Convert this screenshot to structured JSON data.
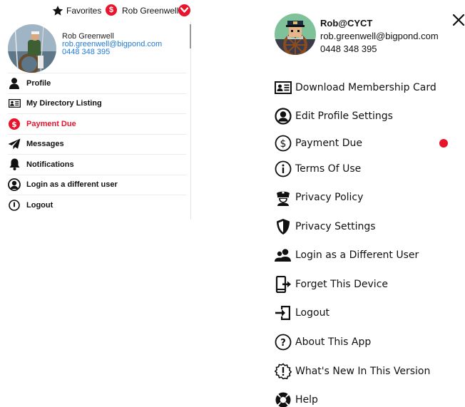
{
  "topbar": {
    "favorites_label": "Favorites",
    "money_symbol": "$",
    "user_name": "Rob Greenwell"
  },
  "dropdown": {
    "profile": {
      "name": "Rob Greenwell",
      "email": "rob.greenwell@bigpond.com",
      "phone": "0448 348 395"
    },
    "items": [
      {
        "label": "Profile",
        "icon": "person-icon"
      },
      {
        "label": "My Directory Listing",
        "icon": "id-card-icon"
      },
      {
        "label": "Payment Due",
        "icon": "dollar-badge-icon",
        "alert": true
      },
      {
        "label": "Messages",
        "icon": "paper-plane-icon"
      },
      {
        "label": "Notifications",
        "icon": "bell-icon"
      },
      {
        "label": "Login as a different user",
        "icon": "user-circle-icon"
      },
      {
        "label": "Logout",
        "icon": "power-icon"
      }
    ]
  },
  "side_menu": {
    "header": {
      "name": "Rob@CYCT",
      "email": "rob.greenwell@bigpond.com",
      "phone": "0448 348 395"
    },
    "items": [
      {
        "label": "Download Membership Card",
        "icon": "id-card-icon"
      },
      {
        "label": "Edit Profile Settings",
        "icon": "user-circle-icon"
      },
      {
        "label": "Payment Due",
        "icon": "dollar-circle-icon",
        "alert": true
      },
      {
        "label": "Terms Of Use",
        "icon": "info-circle-icon"
      },
      {
        "label": "Privacy Policy",
        "icon": "police-officer-icon"
      },
      {
        "label": "Privacy Settings",
        "icon": "shield-icon"
      },
      {
        "label": "Login as a Different User",
        "icon": "users-icon"
      },
      {
        "label": "Forget This Device",
        "icon": "device-exit-icon"
      },
      {
        "label": "Logout",
        "icon": "sign-out-icon"
      },
      {
        "label": "About This App",
        "icon": "question-circle-icon"
      },
      {
        "label": "What's New In This Version",
        "icon": "new-badge-icon"
      },
      {
        "label": "Help",
        "icon": "life-ring-icon"
      }
    ]
  },
  "colors": {
    "alert_red": "#e8142b",
    "link_blue": "#1f7ad6",
    "text": "#111111"
  }
}
